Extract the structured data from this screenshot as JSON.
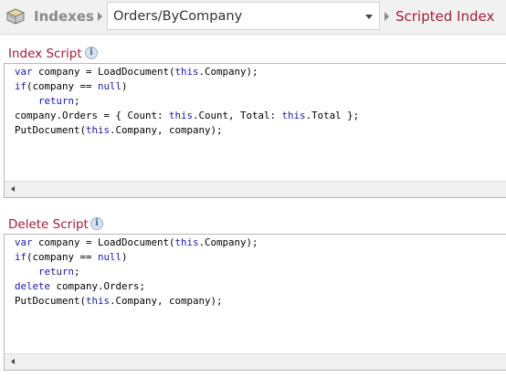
{
  "breadcrumb": {
    "root_label": "Indexes",
    "selected_index": "Orders/ByCompany",
    "current_page": "Scripted Index"
  },
  "index_script": {
    "title": "Index Script",
    "lines": [
      "var company = LoadDocument(this.Company);",
      "if(company == null)",
      "    return;",
      "company.Orders = { Count: this.Count, Total: this.Total };",
      "PutDocument(this.Company, company);"
    ]
  },
  "delete_script": {
    "title": "Delete Script",
    "lines": [
      "var company = LoadDocument(this.Company);",
      "if(company == null)",
      "    return;",
      "delete company.Orders;",
      "PutDocument(this.Company, company);"
    ]
  },
  "icons": {
    "app": "database-icon",
    "separator": "chevron-right-icon",
    "dropdown": "chevron-down-icon",
    "info": "info-icon",
    "scroll_left": "scroll-left-arrow-icon"
  },
  "colors": {
    "accent": "#a0203a",
    "keyword": "#1a1aa6",
    "breadcrumb_muted": "#8a8a8a",
    "bar_background": "#f1f1f1"
  }
}
